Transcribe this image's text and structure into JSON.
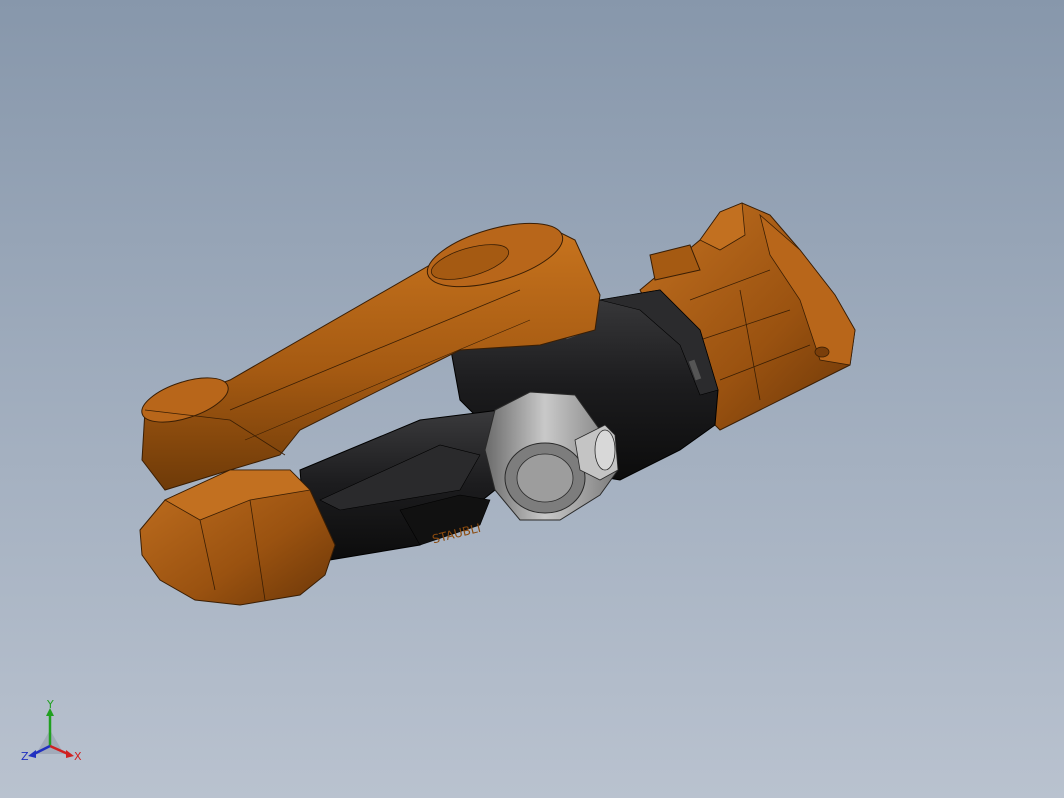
{
  "viewport": {
    "background_top": "#8797ab",
    "background_bottom": "#b9c2cf"
  },
  "model": {
    "body_color": "#a55a12",
    "body_shadow": "#6e3a08",
    "body_highlight": "#c8741e",
    "joint_color": "#1c1c1e",
    "wrist_color": "#9a9a9a",
    "logo_text": "STAUBLI"
  },
  "triad": {
    "x_label": "X",
    "y_label": "Y",
    "z_label": "Z",
    "x_color": "#d02020",
    "y_color": "#20a020",
    "z_color": "#2030c0"
  }
}
